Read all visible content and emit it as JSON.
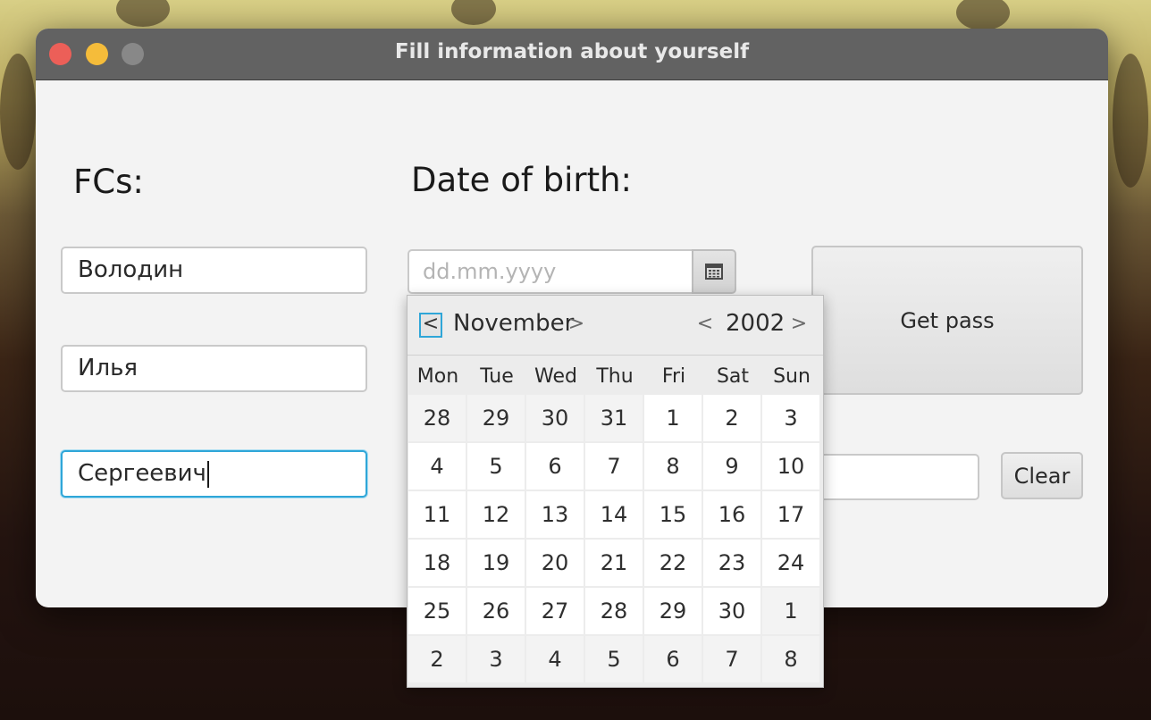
{
  "window": {
    "title": "Fill information about yourself"
  },
  "labels": {
    "fcs": "FCs:",
    "dob": "Date of birth:"
  },
  "fields": {
    "surname": "Володин",
    "first_name": "Илья",
    "patronymic": "Сергеевич"
  },
  "date_picker": {
    "placeholder": "dd.mm.yyyy",
    "month": "November",
    "year": "2002",
    "prev_month": "<",
    "next_month": ">",
    "prev_year": "<",
    "next_year": ">",
    "weekdays": [
      "Mon",
      "Tue",
      "Wed",
      "Thu",
      "Fri",
      "Sat",
      "Sun"
    ],
    "days": [
      {
        "d": "28",
        "other": true
      },
      {
        "d": "29",
        "other": true
      },
      {
        "d": "30",
        "other": true
      },
      {
        "d": "31",
        "other": true
      },
      {
        "d": "1"
      },
      {
        "d": "2"
      },
      {
        "d": "3"
      },
      {
        "d": "4"
      },
      {
        "d": "5"
      },
      {
        "d": "6"
      },
      {
        "d": "7"
      },
      {
        "d": "8"
      },
      {
        "d": "9"
      },
      {
        "d": "10"
      },
      {
        "d": "11"
      },
      {
        "d": "12"
      },
      {
        "d": "13"
      },
      {
        "d": "14"
      },
      {
        "d": "15"
      },
      {
        "d": "16"
      },
      {
        "d": "17"
      },
      {
        "d": "18"
      },
      {
        "d": "19"
      },
      {
        "d": "20"
      },
      {
        "d": "21"
      },
      {
        "d": "22"
      },
      {
        "d": "23"
      },
      {
        "d": "24"
      },
      {
        "d": "25"
      },
      {
        "d": "26"
      },
      {
        "d": "27"
      },
      {
        "d": "28"
      },
      {
        "d": "29"
      },
      {
        "d": "30"
      },
      {
        "d": "1",
        "other": true
      },
      {
        "d": "2",
        "other": true
      },
      {
        "d": "3",
        "other": true
      },
      {
        "d": "4",
        "other": true
      },
      {
        "d": "5",
        "other": true
      },
      {
        "d": "6",
        "other": true
      },
      {
        "d": "7",
        "other": true
      },
      {
        "d": "8",
        "other": true
      }
    ]
  },
  "buttons": {
    "get_pass": "Get pass",
    "clear": "Clear"
  },
  "colors": {
    "focus": "#2fa6d8",
    "titlebar": "#626262",
    "close": "#ec5f58",
    "minimize": "#f5bc3a"
  },
  "icons": {
    "calendar": "calendar-icon",
    "close": "close-icon",
    "minimize": "minimize-icon",
    "zoom": "zoom-icon"
  }
}
